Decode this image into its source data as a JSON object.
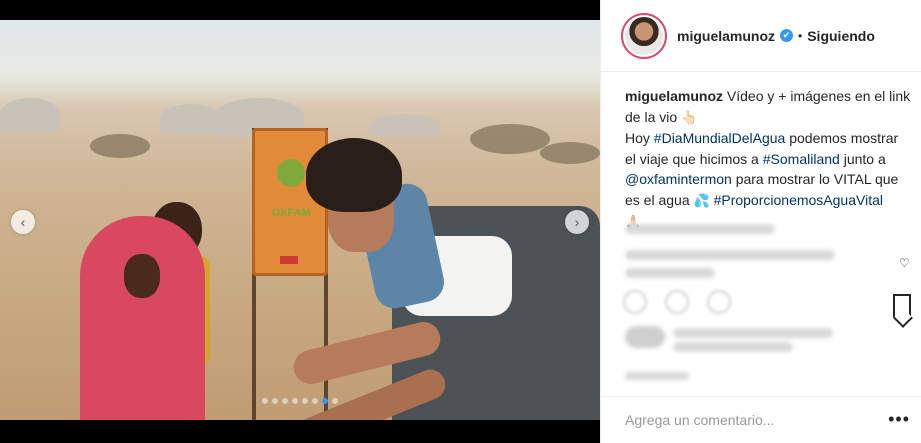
{
  "post": {
    "username": "miguelamunoz",
    "verified_mark": "✔",
    "separator": "•",
    "follow_status": "Siguiendo"
  },
  "caption": {
    "username": "miguelamunoz",
    "line1": " Vídeo y + imágenes en el link de la vio ",
    "emoji_point": "👆🏻",
    "line2_pre": "Hoy ",
    "tag_dia": "#DiaMundialDelAgua",
    "line2_mid": " podemos mostrar el viaje que hicimos a ",
    "tag_somaliland": "#Somaliland",
    "line2_end": " junto a ",
    "mention_oxfam": "@oxfamintermon",
    "line3": " para mostrar lo VITAL que es el agua ",
    "emoji_drops": "💦",
    "tag_proporcionemos": "#ProporcionemosAguaVital",
    "emoji_hands": "🙏🏻"
  },
  "photo": {
    "tank_label": "OXFAM"
  },
  "carousel": {
    "prev_icon": "‹",
    "next_icon": "›"
  },
  "comment_box": {
    "placeholder": "Agrega un comentario...",
    "more_icon": "•••"
  },
  "icons": {
    "heart": "♡"
  }
}
